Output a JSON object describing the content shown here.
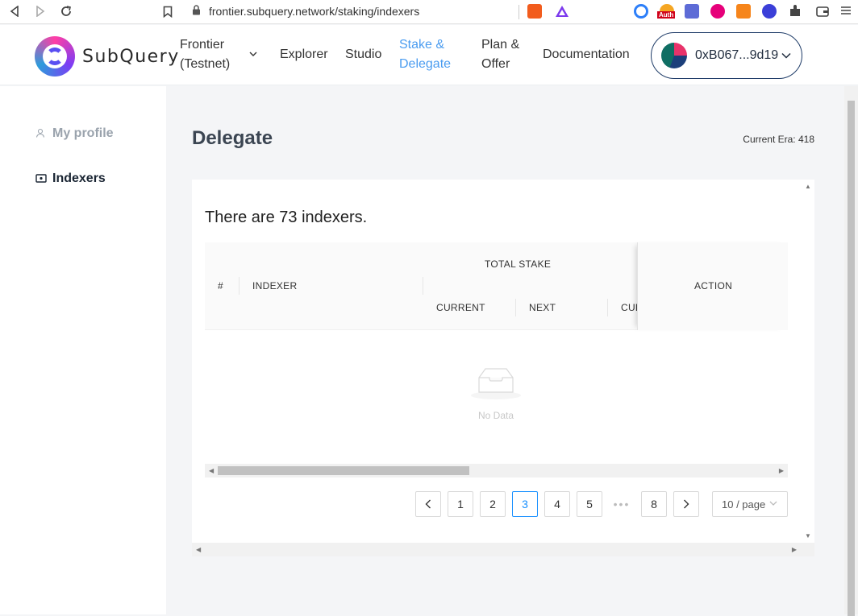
{
  "browser": {
    "url": "frontier.subquery.network/staking/indexers",
    "auth_badge": "Auth"
  },
  "header": {
    "logo_text": "SubQuery",
    "network_label_line1": "Frontier",
    "network_label_line2": "(Testnet)",
    "nav": {
      "explorer": "Explorer",
      "studio": "Studio",
      "stake_line1": "Stake &",
      "stake_line2": "Delegate",
      "plan_line1": "Plan &",
      "plan_line2": "Offer",
      "documentation": "Documentation"
    },
    "wallet_address": "0xB067...9d19"
  },
  "sidebar": {
    "items": [
      {
        "label": "My profile",
        "icon": "user-icon"
      },
      {
        "label": "Indexers",
        "icon": "wallet-icon"
      }
    ]
  },
  "main": {
    "title": "Delegate",
    "current_era": "Current Era: 418",
    "indexer_count_text": "There are 73 indexers.",
    "table": {
      "col_number": "#",
      "col_indexer": "INDEXER",
      "col_total_stake": "TOTAL STAKE",
      "col_current": "CURRENT",
      "col_next": "NEXT",
      "col_cut": "CUR",
      "col_action": "ACTION"
    },
    "empty_text": "No Data",
    "pagination": {
      "pages": [
        "1",
        "2",
        "3",
        "4",
        "5",
        "•••",
        "8"
      ],
      "current_page": "3",
      "page_size": "10 / page"
    }
  },
  "colors": {
    "accent": "#4a9cf0",
    "pagination_active": "#1890ff",
    "title": "#3b4552"
  }
}
